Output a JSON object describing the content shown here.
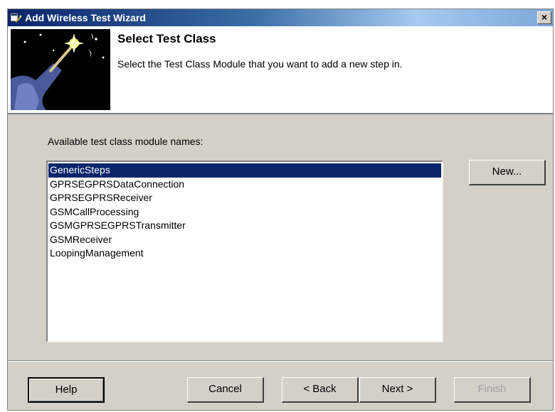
{
  "window": {
    "title": "Add Wireless Test Wizard",
    "close_glyph": "×"
  },
  "header": {
    "title": "Select Test Class",
    "subtitle": "Select the Test Class Module that you want to add a new step in."
  },
  "content": {
    "list_label": "Available test class module names:",
    "items": [
      "GenericSteps",
      "GPRSEGPRSDataConnection",
      "GPRSEGPRSReceiver",
      "GSMCallProcessing",
      "GSMGPRSEGPRSTransmitter",
      "GSMReceiver",
      "LoopingManagement"
    ],
    "selected_index": 0,
    "new_button": "New..."
  },
  "footer": {
    "help": "Help",
    "cancel": "Cancel",
    "back": "< Back",
    "next": "Next >",
    "finish": "Finish"
  },
  "colors": {
    "selection": "#0a246a",
    "dialog_bg": "#d4d0c8",
    "title_bar": "#0a246a"
  },
  "icons": [
    "wizard-app-icon",
    "close-icon",
    "wizard-wand-image"
  ]
}
